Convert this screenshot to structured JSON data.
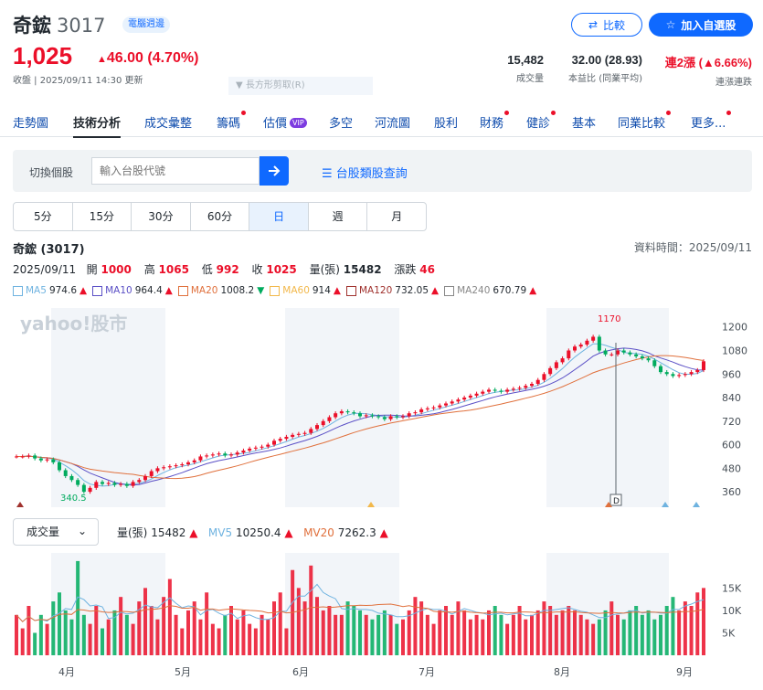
{
  "stock": {
    "name": "奇鋐",
    "code": "3017",
    "badge": "電腦週邊",
    "price": "1,025",
    "change": "46.00 (4.70%)",
    "status": "收盤 | 2025/09/11 14:30 更新",
    "ghost_label": "長方形剪取(R)"
  },
  "buttons": {
    "compare": "比較",
    "watchlist": "加入自選股"
  },
  "stats": [
    {
      "value": "15,482",
      "label": "成交量"
    },
    {
      "value": "32.00 (28.93)",
      "label": "本益比 (同業平均)"
    },
    {
      "value": "連2漲 (▲6.66%)",
      "label": "連漲連跌"
    }
  ],
  "nav": [
    "走勢圖",
    "技術分析",
    "成交彙整",
    "籌碼",
    "估價",
    "多空",
    "河流圖",
    "股利",
    "財務",
    "健診",
    "基本",
    "同業比較",
    "更多..."
  ],
  "nav_vip_label": "VIP",
  "search": {
    "label": "切換個股",
    "placeholder": "輸入台股代號",
    "browse": "台股類股查詢"
  },
  "periods": [
    "5分",
    "15分",
    "30分",
    "60分",
    "日",
    "週",
    "月"
  ],
  "header": {
    "stock_name": "奇鋐 (3017)",
    "data_time": "資料時間：2025/09/11"
  },
  "ohlc": {
    "date": "2025/09/11",
    "open_label": "開",
    "open": "1000",
    "high_label": "高",
    "high": "1065",
    "low_label": "低",
    "low": "992",
    "close_label": "收",
    "close": "1025",
    "vol_label": "量(張)",
    "vol": "15482",
    "chg_label": "漲跌",
    "chg": "46"
  },
  "ma": [
    {
      "label": "MA5",
      "value": "974.6",
      "arrow": "▲",
      "color": "#6fb3e0"
    },
    {
      "label": "MA10",
      "value": "964.4",
      "arrow": "▲",
      "color": "#5b50c6"
    },
    {
      "label": "MA20",
      "value": "1008.2",
      "arrow": "▼",
      "color": "#e0703c"
    },
    {
      "label": "MA60",
      "value": "914",
      "arrow": "▲",
      "color": "#f2b84b"
    },
    {
      "label": "MA120",
      "value": "732.05",
      "arrow": "▲",
      "color": "#a0322e"
    },
    {
      "label": "MA240",
      "value": "670.79",
      "arrow": "▲",
      "color": "#888888"
    }
  ],
  "watermark": "yahoo!股市",
  "volume": {
    "select": "成交量",
    "vol_label": "量(張)",
    "vol": "15482",
    "mv5_label": "MV5",
    "mv5": "10250.4",
    "mv20_label": "MV20",
    "mv20": "7262.3"
  },
  "chart_data": {
    "type": "candlestick",
    "price_ticks": [
      1200,
      1080,
      960,
      840,
      720,
      600,
      480,
      360
    ],
    "annotations": {
      "high": "1170",
      "low": "340.5",
      "marker": "D"
    },
    "volume_ticks": [
      "15K",
      "10K",
      "5K"
    ],
    "months": [
      "4月",
      "5月",
      "6月",
      "7月",
      "8月",
      "9月"
    ],
    "close": [
      540,
      540,
      545,
      530,
      520,
      525,
      510,
      470,
      440,
      420,
      395,
      360,
      380,
      410,
      400,
      405,
      395,
      400,
      390,
      410,
      420,
      440,
      465,
      480,
      485,
      490,
      495,
      500,
      510,
      520,
      540,
      545,
      550,
      555,
      545,
      550,
      560,
      570,
      580,
      585,
      590,
      600,
      620,
      630,
      640,
      650,
      655,
      660,
      680,
      700,
      720,
      740,
      760,
      770,
      765,
      760,
      745,
      750,
      745,
      740,
      730,
      745,
      740,
      745,
      760,
      765,
      780,
      785,
      790,
      800,
      810,
      820,
      830,
      840,
      850,
      860,
      870,
      880,
      875,
      870,
      880,
      885,
      890,
      900,
      910,
      930,
      960,
      990,
      1020,
      1040,
      1080,
      1100,
      1110,
      1130,
      1150,
      1080,
      1060,
      1060,
      1080,
      1070,
      1060,
      1050,
      1040,
      1030,
      1000,
      970,
      960,
      950,
      955,
      960,
      970,
      980,
      1025
    ],
    "volume_k": [
      9,
      6,
      11,
      5,
      9,
      7,
      12,
      14,
      10,
      8,
      21,
      9,
      7,
      11,
      6,
      8,
      10,
      13,
      9,
      7,
      12,
      15,
      11,
      8,
      13,
      17,
      9,
      6,
      10,
      12,
      8,
      14,
      7,
      6,
      9,
      11,
      8,
      10,
      7,
      6,
      9,
      8,
      12,
      14,
      6,
      19,
      15,
      12,
      20,
      13,
      10,
      11,
      9,
      9,
      12,
      11,
      10,
      9,
      8,
      9,
      10,
      9,
      7,
      8,
      10,
      13,
      12,
      9,
      7,
      10,
      11,
      9,
      12,
      10,
      8,
      9,
      8,
      10,
      11,
      9,
      7,
      9,
      11,
      8,
      9,
      10,
      12,
      11,
      9,
      10,
      11,
      10,
      9,
      8,
      7,
      8,
      10,
      12,
      9,
      8,
      10,
      11,
      9,
      10,
      8,
      9,
      11,
      13,
      10,
      12,
      11,
      14,
      15
    ]
  }
}
